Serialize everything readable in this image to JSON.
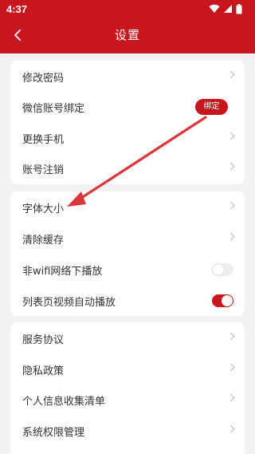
{
  "status_bar": {
    "time": "4:37"
  },
  "nav": {
    "title": "设置"
  },
  "groups": [
    {
      "items": [
        {
          "label": "修改密码",
          "control": "chevron"
        },
        {
          "label": "微信账号绑定",
          "control": "badge",
          "badge": "绑定"
        },
        {
          "label": "更换手机",
          "control": "chevron"
        },
        {
          "label": "账号注销",
          "control": "chevron"
        }
      ]
    },
    {
      "items": [
        {
          "label": "字体大小",
          "control": "chevron"
        },
        {
          "label": "清除缓存",
          "control": "chevron"
        },
        {
          "label": "非wifi网络下播放",
          "control": "toggle",
          "on": false
        },
        {
          "label": "列表页视频自动播放",
          "control": "toggle",
          "on": true
        }
      ]
    },
    {
      "items": [
        {
          "label": "服务协议",
          "control": "chevron"
        },
        {
          "label": "隐私政策",
          "control": "chevron"
        },
        {
          "label": "个人信息收集清单",
          "control": "chevron"
        },
        {
          "label": "系统权限管理",
          "control": "chevron"
        }
      ]
    }
  ],
  "colors": {
    "accent": "#c8161e",
    "background": "#f2f2f2",
    "card": "#ffffff",
    "arrow": "#d9363e"
  },
  "icons": [
    "wifi-icon",
    "signal-icon",
    "battery-icon",
    "back-arrow-icon",
    "chevron-right-icon"
  ]
}
